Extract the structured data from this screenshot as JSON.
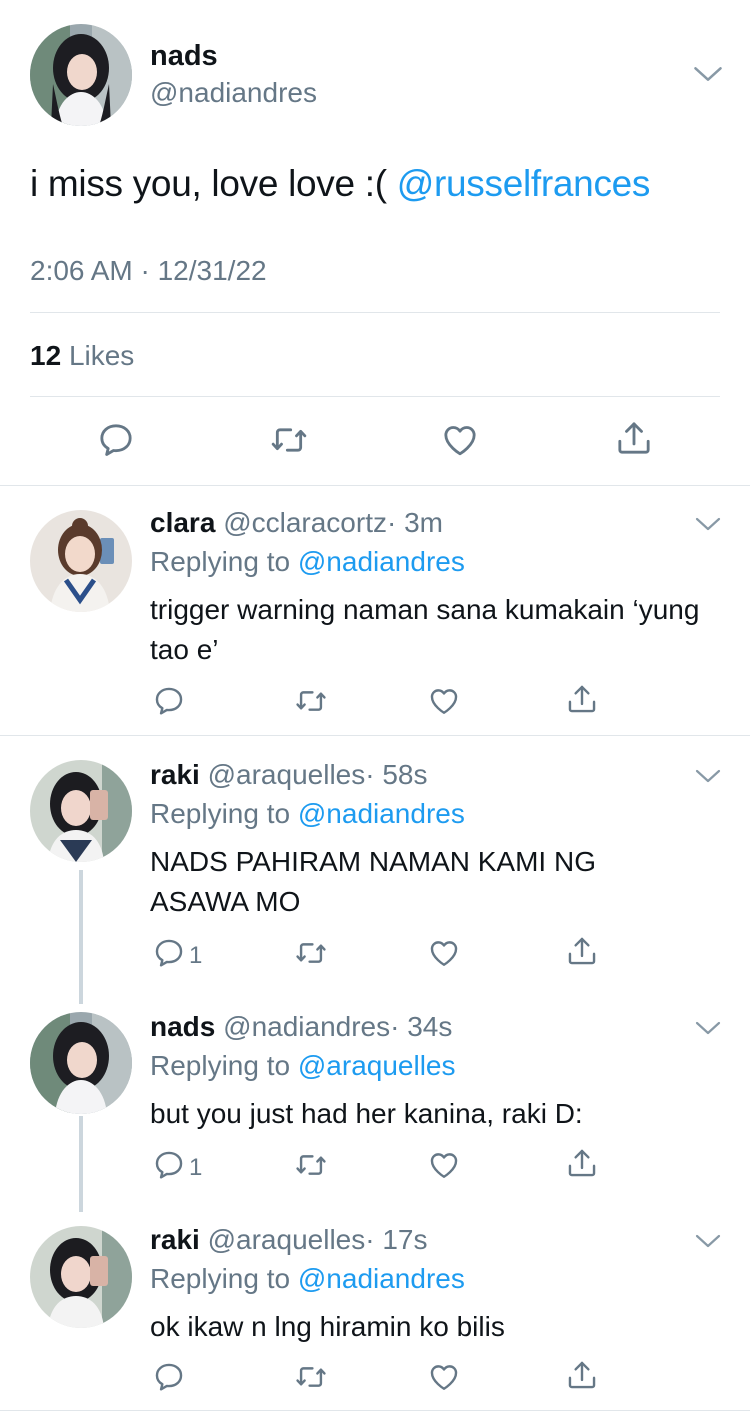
{
  "main_tweet": {
    "name": "nads",
    "handle": "@nadiandres",
    "text": "i miss you, love love :(",
    "mention": "@russelfrances",
    "timestamp": "2:06 AM · 12/31/22",
    "likes_count": "12",
    "likes_label": "Likes",
    "icons": [
      "reply-icon",
      "retweet-icon",
      "like-icon",
      "share-icon",
      "chevron-down-icon"
    ]
  },
  "replies": [
    {
      "name": "clara",
      "handle": "@cclaracortz",
      "time": "· 3m",
      "replying_label": "Replying to",
      "replying_to": "@nadiandres",
      "text": "trigger warning naman sana kumakain ‘yung tao e’",
      "reply_count": ""
    },
    {
      "name": "raki",
      "handle": "@araquelles",
      "time": "· 58s",
      "replying_label": "Replying to",
      "replying_to": "@nadiandres",
      "text": "NADS PAHIRAM NAMAN KAMI NG ASAWA MO",
      "reply_count": "1"
    },
    {
      "name": "nads",
      "handle": "@nadiandres",
      "time": "· 34s",
      "replying_label": "Replying to",
      "replying_to": "@araquelles",
      "text": "but you just had her kanina, raki D:",
      "reply_count": "1"
    },
    {
      "name": "raki",
      "handle": "@araquelles",
      "time": "· 17s",
      "replying_label": "Replying to",
      "replying_to": "@nadiandres",
      "text": "ok ikaw n lng hiramin ko bilis",
      "reply_count": ""
    }
  ],
  "colors": {
    "link": "#1d9bf0",
    "muted": "#657786",
    "text": "#0f1419",
    "divider": "#e1e6ea",
    "thread_line": "#ccd6dd"
  }
}
